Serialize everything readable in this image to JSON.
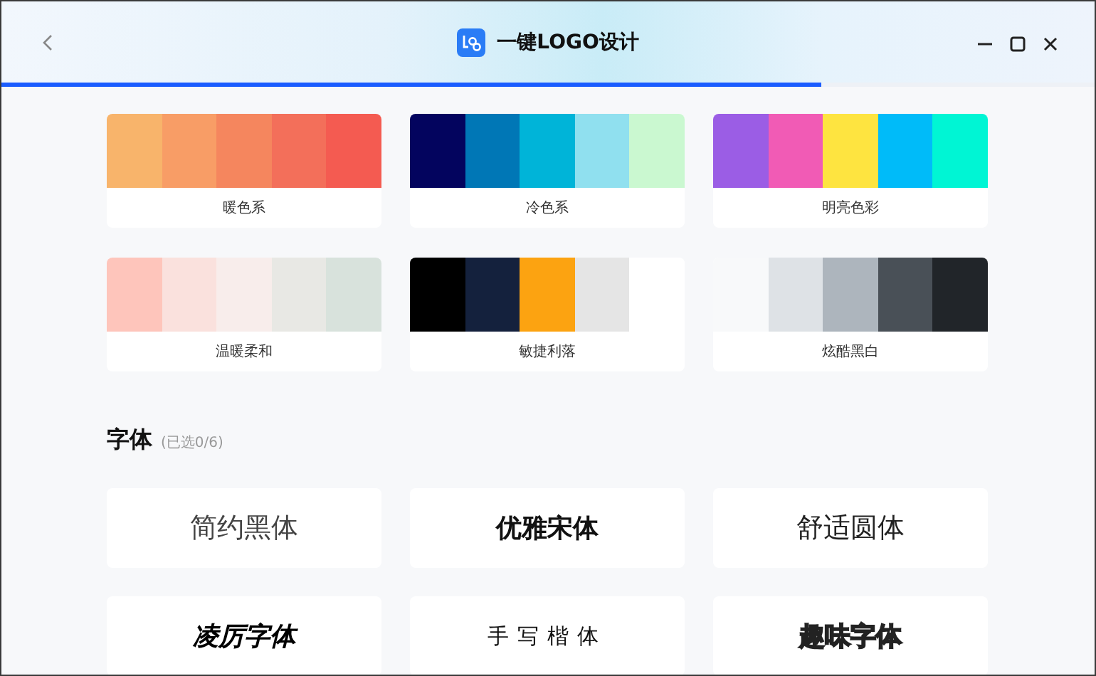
{
  "window": {
    "title": "一键LOGO设计",
    "progress": {
      "level": 0.75
    }
  },
  "palettes": [
    {
      "label": "暖色系",
      "swatches": [
        {
          "color": "#f8b46b"
        },
        {
          "color": "#f89d66"
        },
        {
          "color": "#f5865e"
        },
        {
          "color": "#f36f5a"
        },
        {
          "color": "#f45b51"
        }
      ]
    },
    {
      "label": "冷色系",
      "swatches": [
        {
          "color": "#03045e"
        },
        {
          "color": "#0077b6"
        },
        {
          "color": "#00b4d8"
        },
        {
          "color": "#90e0ef"
        },
        {
          "color": "#caf8d0"
        }
      ]
    },
    {
      "label": "明亮色彩",
      "swatches": [
        {
          "color": "#9b5de5"
        },
        {
          "color": "#f15bb5"
        },
        {
          "color": "#fee440"
        },
        {
          "color": "#00bbf9"
        },
        {
          "color": "#00f5d4"
        }
      ]
    },
    {
      "label": "温暖柔和",
      "swatches": [
        {
          "color": "#fec5bb"
        },
        {
          "color": "#fae1dd"
        },
        {
          "color": "#f8edeb"
        },
        {
          "color": "#e8e8e4"
        },
        {
          "color": "#d8e2dc"
        }
      ]
    },
    {
      "label": "敏捷利落",
      "swatches": [
        {
          "color": "#000000"
        },
        {
          "color": "#14213d"
        },
        {
          "color": "#fca311"
        },
        {
          "color": "#e5e5e5"
        },
        {
          "color": "#ffffff"
        }
      ]
    },
    {
      "label": "炫酷黑白",
      "swatches": [
        {
          "color": "#f8f9fa"
        },
        {
          "color": "#dee2e6"
        },
        {
          "color": "#adb5bd"
        },
        {
          "color": "#495057"
        },
        {
          "color": "#212529"
        }
      ]
    }
  ],
  "fonts": {
    "heading": "字体",
    "count": "(已选0/6)",
    "items": [
      {
        "label": "简约黑体",
        "kind": "light"
      },
      {
        "label": "优雅宋体",
        "kind": "serif"
      },
      {
        "label": "舒适圆体",
        "kind": "round"
      },
      {
        "label": "凌厉字体",
        "kind": "heavy"
      },
      {
        "label": "手写楷体",
        "kind": "script"
      },
      {
        "label": "趣味字体",
        "kind": "fun"
      }
    ]
  }
}
